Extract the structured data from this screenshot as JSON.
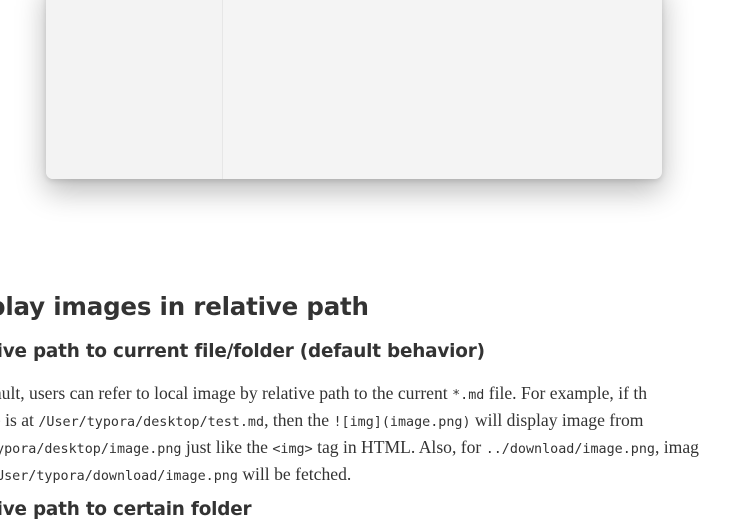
{
  "section": {
    "heading": "play images in relative path",
    "sub1": "tive path to current file/folder (default behavior)",
    "sub2": "tive path to certain folder"
  },
  "paragraph": {
    "line1": {
      "t1": "fault, users can refer to local image by relative path to the current ",
      "c1": "*.md",
      "t2": " file. For example, if th"
    },
    "line2": {
      "t1": "le is at ",
      "c1": "/User/typora/desktop/test.md",
      "t2": ", then the ",
      "c2": "![img](image.png)",
      "t3": " will display image from"
    },
    "line3": {
      "c1": "typora/desktop/image.png",
      "t1": " just like the ",
      "c2": "<img>",
      "t2": " tag in HTML. Also, for ",
      "c3": "../download/image.png",
      "t3": ", imag"
    },
    "line4": {
      "c1": "/User/typora/download/image.png",
      "t1": " will be fetched."
    }
  }
}
